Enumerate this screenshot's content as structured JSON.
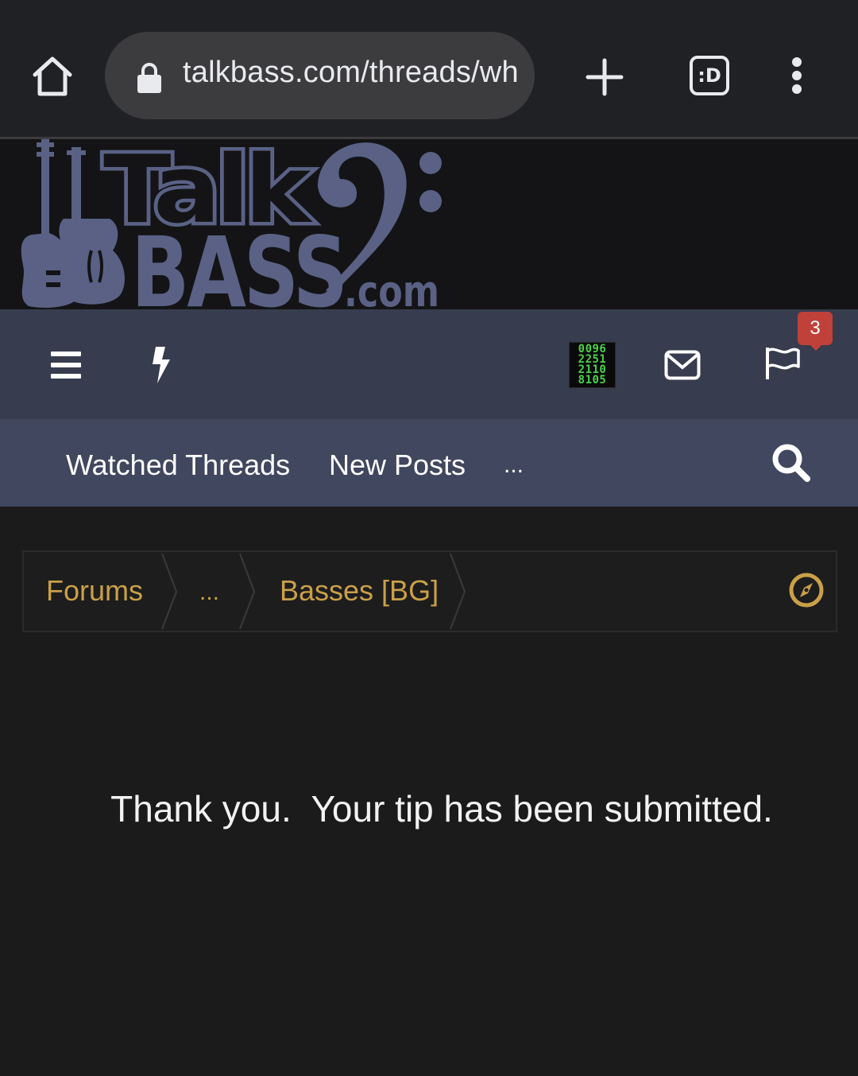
{
  "browser": {
    "url": "talkbass.com/threads/wh",
    "tab_button_label": ":D",
    "icons": {
      "home": "home-icon",
      "lock": "lock-icon",
      "new_tab": "plus-icon",
      "tabs": "tabs-icon",
      "menu": "kebab-menu-icon"
    }
  },
  "site": {
    "logo": {
      "line1": "Talk",
      "line2": "BASS",
      "suffix": ".com",
      "color": "#5a6185"
    }
  },
  "navbar": {
    "avatar_digits": [
      "0096",
      "2251",
      "2110",
      "8105"
    ],
    "alerts_count": "3",
    "icons": {
      "menu": "hamburger-icon",
      "whats_new": "lightning-bolt-icon",
      "inbox": "envelope-icon",
      "alerts": "flag-icon"
    }
  },
  "subnav": {
    "items": [
      {
        "label": "Watched Threads"
      },
      {
        "label": "New Posts"
      },
      {
        "label": "..."
      }
    ],
    "search_icon": "search-icon"
  },
  "breadcrumb": {
    "items": [
      {
        "label": "Forums"
      },
      {
        "label": "..."
      },
      {
        "label": "Basses [BG]"
      }
    ],
    "jump_icon": "compass-icon",
    "color": "#caa048"
  },
  "main": {
    "message": "Thank you.  Your tip has been submitted."
  },
  "colors": {
    "page_bg": "#1b1b1c",
    "navbar_bg": "#373c4e",
    "subnav_bg": "#40475e",
    "badge": "#c0413a",
    "accent_gold": "#caa048"
  }
}
